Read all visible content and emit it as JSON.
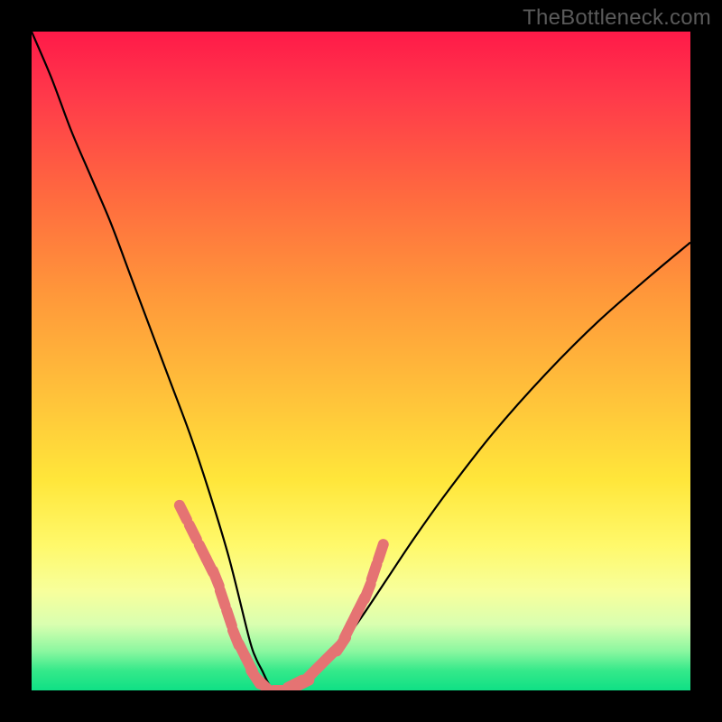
{
  "watermark": "TheBottleneck.com",
  "colors": {
    "background": "#000000",
    "curve_stroke": "#000000",
    "marker_fill": "#e57373",
    "gradient_top": "#ff1a49",
    "gradient_bottom": "#0fe085"
  },
  "chart_data": {
    "type": "line",
    "title": "",
    "xlabel": "",
    "ylabel": "",
    "xlim": [
      0,
      100
    ],
    "ylim": [
      0,
      100
    ],
    "grid": false,
    "note": "A V-shaped bottleneck curve plotted over a vertical red→yellow→green gradient. Values are read approximately from pixel positions (y is percentage from bottom; higher = worse / more red).",
    "series": [
      {
        "name": "bottleneck-curve",
        "x": [
          0,
          3,
          6,
          9,
          12,
          15,
          18,
          21,
          24,
          27,
          30,
          33,
          34,
          35,
          36,
          37,
          38,
          40,
          42,
          44,
          47,
          50,
          54,
          58,
          63,
          70,
          78,
          86,
          94,
          100
        ],
        "y": [
          100,
          93,
          85,
          78,
          71,
          63,
          55,
          47,
          39,
          30,
          20,
          8,
          5,
          3,
          1,
          0,
          0,
          1,
          2,
          4,
          7,
          11,
          17,
          23,
          30,
          39,
          48,
          56,
          63,
          68
        ]
      }
    ],
    "markers": [
      {
        "name": "highlighted-range-left",
        "x": [
          23,
          24.5,
          26,
          27,
          28,
          29,
          30,
          31,
          32,
          33,
          34,
          35,
          36
        ],
        "y": [
          27,
          24,
          21,
          19,
          17,
          14,
          11,
          8,
          6,
          4,
          2,
          1,
          0
        ]
      },
      {
        "name": "highlighted-range-right",
        "x": [
          38,
          39,
          40,
          41,
          42,
          43,
          44,
          45,
          46,
          47,
          48,
          49,
          50,
          51,
          52,
          53
        ],
        "y": [
          0,
          0,
          1,
          1,
          2,
          3,
          4,
          5,
          6,
          7,
          9,
          11,
          13,
          15,
          18,
          21
        ]
      }
    ]
  }
}
